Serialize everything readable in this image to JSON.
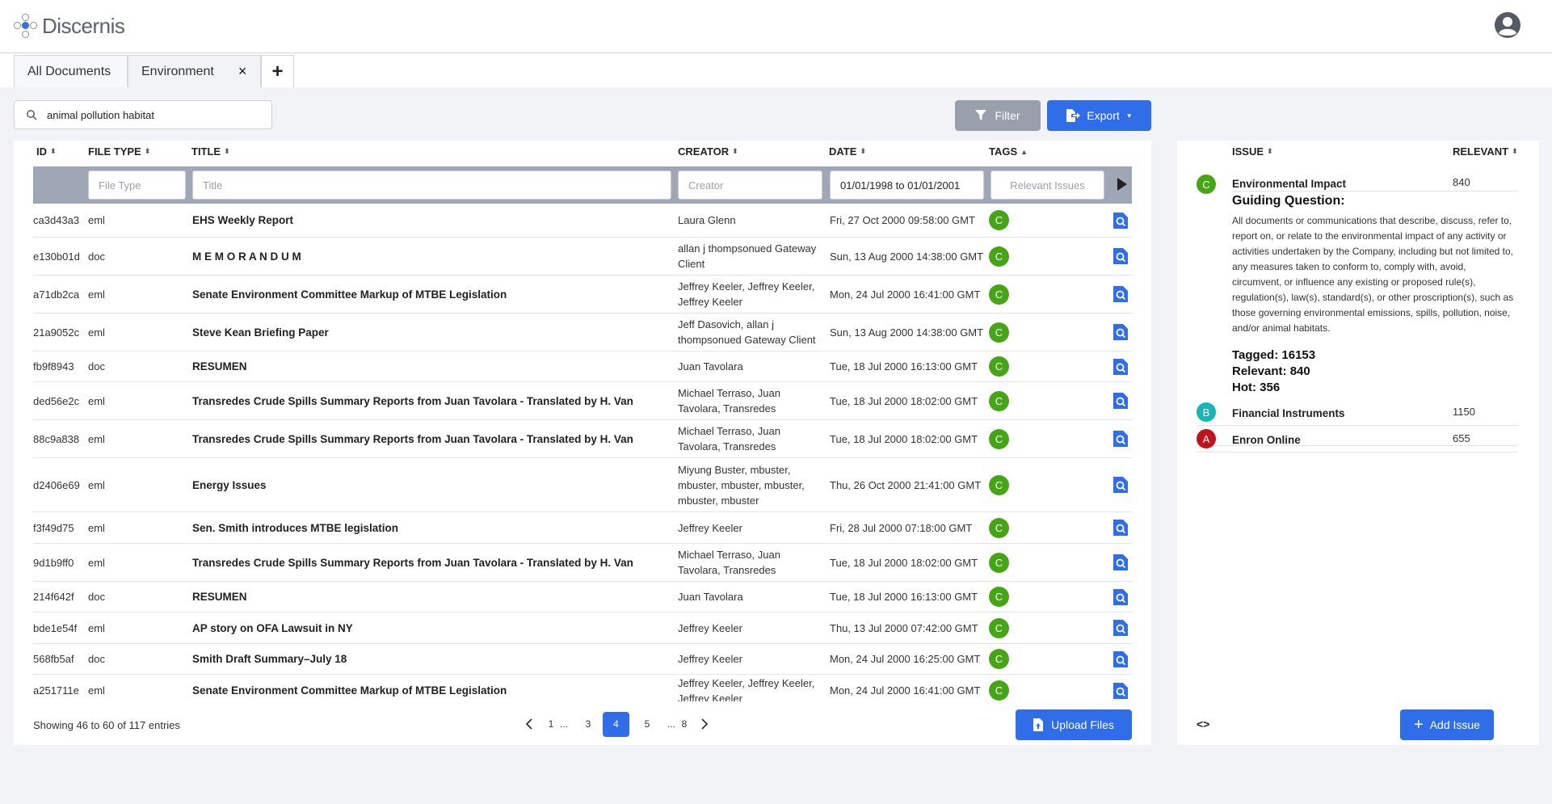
{
  "app": {
    "name": "Discernis"
  },
  "tabs": [
    {
      "label": "All Documents"
    },
    {
      "label": "Environment",
      "close": "×"
    },
    {
      "label": "+"
    }
  ],
  "search": {
    "value": "animal pollution habitat"
  },
  "toolbar": {
    "filter_label": "Filter",
    "export_label": "Export"
  },
  "table": {
    "headers": {
      "id": "ID",
      "file_type": "FILE TYPE",
      "title": "TITLE",
      "creator": "CREATOR",
      "date": "DATE",
      "tags": "TAGS"
    },
    "filters": {
      "file_type_placeholder": "File Type",
      "title_placeholder": "Title",
      "creator_placeholder": "Creator",
      "date_value": "01/01/1998 to 01/01/2001",
      "tags_placeholder": "Relevant Issues"
    },
    "rows": [
      {
        "id": "ca3d43a3",
        "file_type": "eml",
        "title": "EHS Weekly Report",
        "creator": "Laura Glenn",
        "date": "Fri, 27 Oct 2000 09:58:00 GMT",
        "tag": "C"
      },
      {
        "id": "e130b01d",
        "file_type": "doc",
        "title": "M E M O R A N D U M",
        "creator": "allan j thompsonued Gateway Client",
        "date": "Sun, 13 Aug 2000 14:38:00 GMT",
        "tag": "C"
      },
      {
        "id": "a71db2ca",
        "file_type": "eml",
        "title": "Senate Environment Committee Markup of MTBE Legislation",
        "creator": "Jeffrey Keeler, Jeffrey Keeler, Jeffrey Keeler",
        "date": "Mon, 24 Jul 2000 16:41:00 GMT",
        "tag": "C"
      },
      {
        "id": "21a9052c",
        "file_type": "eml",
        "title": "Steve Kean Briefing Paper",
        "creator": "Jeff Dasovich, allan j thompsonued Gateway Client",
        "date": "Sun, 13 Aug 2000 14:38:00 GMT",
        "tag": "C"
      },
      {
        "id": "fb9f8943",
        "file_type": "doc",
        "title": "RESUMEN",
        "creator": "Juan Tavolara",
        "date": "Tue, 18 Jul 2000 16:13:00 GMT",
        "tag": "C"
      },
      {
        "id": "ded56e2c",
        "file_type": "eml",
        "title": "Transredes Crude Spills Summary Reports from Juan Tavolara - Translated by H. Van",
        "creator": "Michael Terraso, Juan Tavolara, Transredes",
        "date": "Tue, 18 Jul 2000 18:02:00 GMT",
        "tag": "C"
      },
      {
        "id": "88c9a838",
        "file_type": "eml",
        "title": "Transredes Crude Spills Summary Reports from Juan Tavolara - Translated by H. Van",
        "creator": "Michael Terraso, Juan Tavolara, Transredes",
        "date": "Tue, 18 Jul 2000 18:02:00 GMT",
        "tag": "C"
      },
      {
        "id": "d2406e69",
        "file_type": "eml",
        "title": "Energy Issues",
        "creator": "Miyung Buster, mbuster, mbuster, mbuster, mbuster, mbuster, mbuster",
        "date": "Thu, 26 Oct 2000 21:41:00 GMT",
        "tag": "C"
      },
      {
        "id": "f3f49d75",
        "file_type": "eml",
        "title": "Sen. Smith introduces MTBE legislation",
        "creator": "Jeffrey Keeler",
        "date": "Fri, 28 Jul 2000 07:18:00 GMT",
        "tag": "C"
      },
      {
        "id": "9d1b9ff0",
        "file_type": "eml",
        "title": "Transredes Crude Spills Summary Reports from Juan Tavolara - Translated by H. Van",
        "creator": "Michael Terraso, Juan Tavolara, Transredes",
        "date": "Tue, 18 Jul 2000 18:02:00 GMT",
        "tag": "C"
      },
      {
        "id": "214f642f",
        "file_type": "doc",
        "title": "RESUMEN",
        "creator": "Juan Tavolara",
        "date": "Tue, 18 Jul 2000 16:13:00 GMT",
        "tag": "C"
      },
      {
        "id": "bde1e54f",
        "file_type": "eml",
        "title": "AP story on OFA Lawsuit in NY",
        "creator": "Jeffrey Keeler",
        "date": "Thu, 13 Jul 2000 07:42:00 GMT",
        "tag": "C"
      },
      {
        "id": "568fb5af",
        "file_type": "doc",
        "title": "Smith Draft Summary–July 18",
        "creator": "Jeffrey Keeler",
        "date": "Mon, 24 Jul 2000 16:25:00 GMT",
        "tag": "C"
      },
      {
        "id": "a251711e",
        "file_type": "eml",
        "title": "Senate Environment Committee Markup of MTBE Legislation",
        "creator": "Jeffrey Keeler, Jeffrey Keeler, Jeffrey Keeler",
        "date": "Mon, 24 Jul 2000 16:41:00 GMT",
        "tag": "C"
      }
    ]
  },
  "pagination": {
    "showing": "Showing 46 to 60 of 117 entries",
    "pages": [
      "1",
      "...",
      "3",
      "4",
      "5",
      "...",
      "8"
    ],
    "current": "4"
  },
  "upload_label": "Upload Files",
  "issues": {
    "headers": {
      "issue": "ISSUE",
      "relevant": "RELEVANT"
    },
    "items": [
      {
        "badge": "C",
        "color": "#45a516",
        "name": "Environmental Impact",
        "count": "840"
      },
      {
        "badge": "B",
        "color": "#19b3b8",
        "name": "Financial Instruments",
        "count": "1150"
      },
      {
        "badge": "A",
        "color": "#c0141d",
        "name": "Enron Online",
        "count": "655"
      }
    ],
    "guiding_title": "Guiding Question:",
    "guiding_text": "All documents or communications that describe, discuss, refer to, report on, or relate to the environmental impact of any activity or activities undertaken by the Company, including but not limited to, any measures taken to conform to, comply with, avoid, circumvent, or influence any existing or proposed rule(s), regulation(s), law(s), standard(s), or other proscription(s), such as those governing environmental emissions, spills, pollution, noise, and/or animal habitats.",
    "tagged": "Tagged: 16153",
    "relevant": "Relevant: 840",
    "hot": "Hot: 356",
    "code_toggle": "<>",
    "add_label": "Add Issue"
  }
}
